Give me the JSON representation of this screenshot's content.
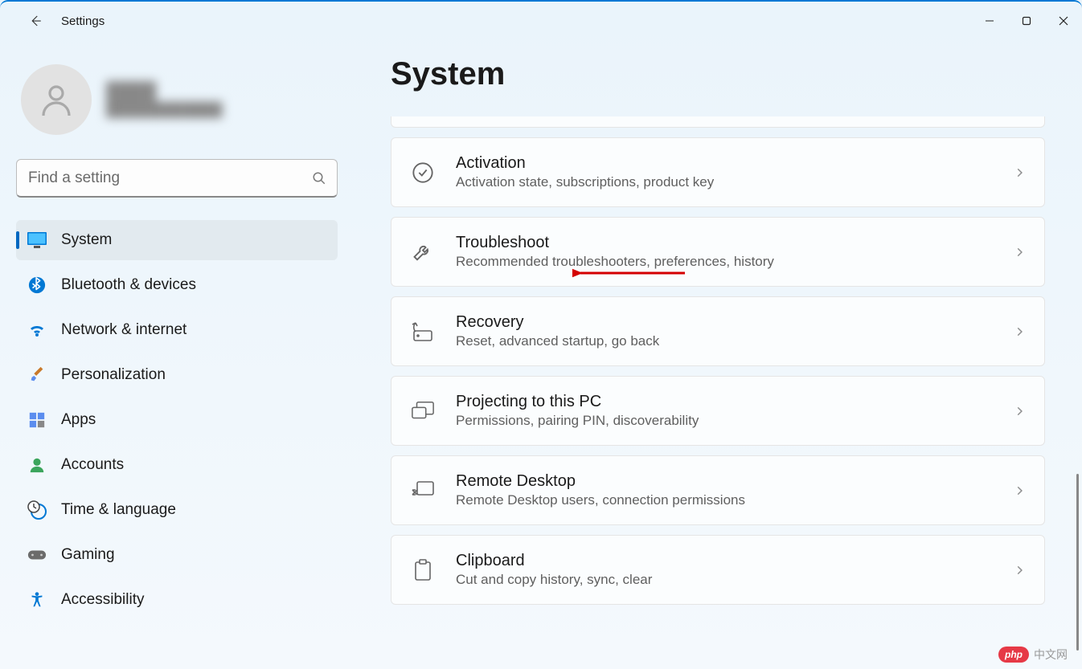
{
  "app_title": "Settings",
  "search": {
    "placeholder": "Find a setting"
  },
  "profile": {
    "name": "████",
    "email": "████████████"
  },
  "sidebar": {
    "items": [
      {
        "label": "System",
        "icon": "display-icon",
        "selected": true
      },
      {
        "label": "Bluetooth & devices",
        "icon": "bluetooth-icon",
        "selected": false
      },
      {
        "label": "Network & internet",
        "icon": "wifi-icon",
        "selected": false
      },
      {
        "label": "Personalization",
        "icon": "brush-icon",
        "selected": false
      },
      {
        "label": "Apps",
        "icon": "apps-icon",
        "selected": false
      },
      {
        "label": "Accounts",
        "icon": "person-icon",
        "selected": false
      },
      {
        "label": "Time & language",
        "icon": "clock-globe-icon",
        "selected": false
      },
      {
        "label": "Gaming",
        "icon": "gamepad-icon",
        "selected": false
      },
      {
        "label": "Accessibility",
        "icon": "accessibility-icon",
        "selected": false
      }
    ]
  },
  "page": {
    "title": "System"
  },
  "cards": [
    {
      "title": "Activation",
      "sub": "Activation state, subscriptions, product key",
      "icon": "check-circle-icon"
    },
    {
      "title": "Troubleshoot",
      "sub": "Recommended troubleshooters, preferences, history",
      "icon": "wrench-icon"
    },
    {
      "title": "Recovery",
      "sub": "Reset, advanced startup, go back",
      "icon": "recovery-icon"
    },
    {
      "title": "Projecting to this PC",
      "sub": "Permissions, pairing PIN, discoverability",
      "icon": "projecting-icon"
    },
    {
      "title": "Remote Desktop",
      "sub": "Remote Desktop users, connection permissions",
      "icon": "remote-desktop-icon"
    },
    {
      "title": "Clipboard",
      "sub": "Cut and copy history, sync, clear",
      "icon": "clipboard-icon"
    }
  ],
  "watermark": {
    "badge": "php",
    "text": "中文网"
  },
  "colors": {
    "accent": "#0067c0",
    "annotation": "#d40000"
  }
}
